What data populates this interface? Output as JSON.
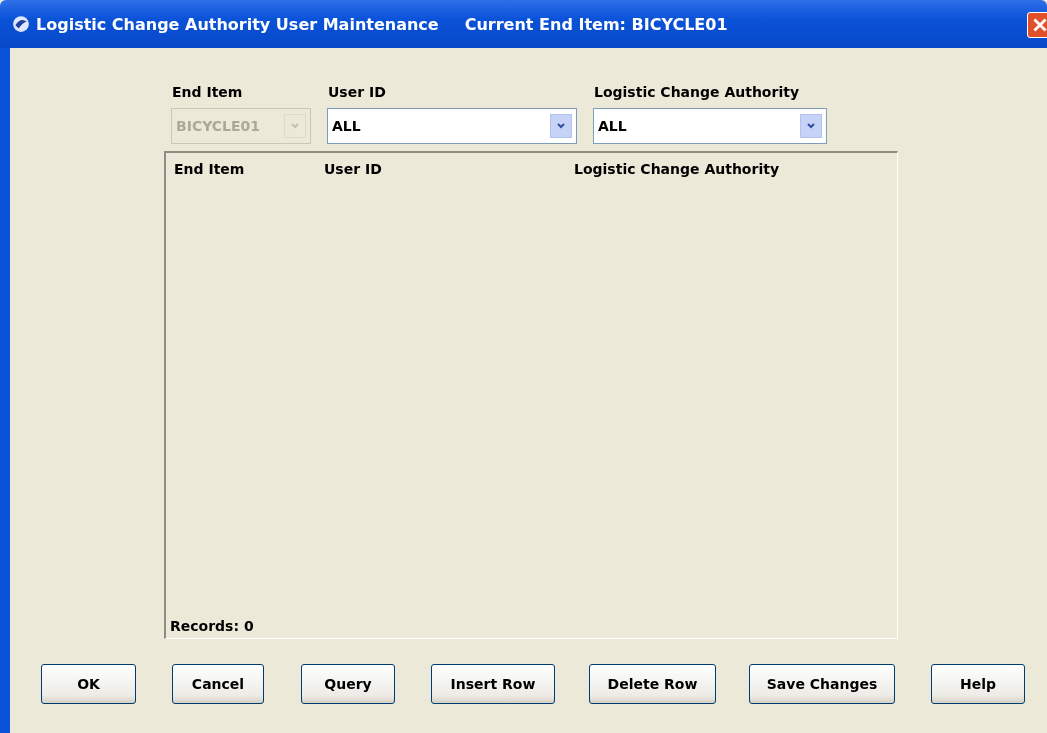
{
  "window": {
    "title": "Logistic Change Authority User Maintenance",
    "subtitle": "Current End Item: BICYCLE01"
  },
  "filters": [
    {
      "label": "End Item",
      "value": "BICYCLE01",
      "disabled": true
    },
    {
      "label": "User ID",
      "value": "ALL",
      "disabled": false
    },
    {
      "label": "Logistic Change Authority",
      "value": "ALL",
      "disabled": false
    }
  ],
  "table": {
    "columns": [
      "End Item",
      "User ID",
      "Logistic Change Authority"
    ],
    "records": "Records: 0"
  },
  "buttons": [
    "OK",
    "Cancel",
    "Query",
    "Insert Row",
    "Delete Row",
    "Save Changes",
    "Help"
  ]
}
